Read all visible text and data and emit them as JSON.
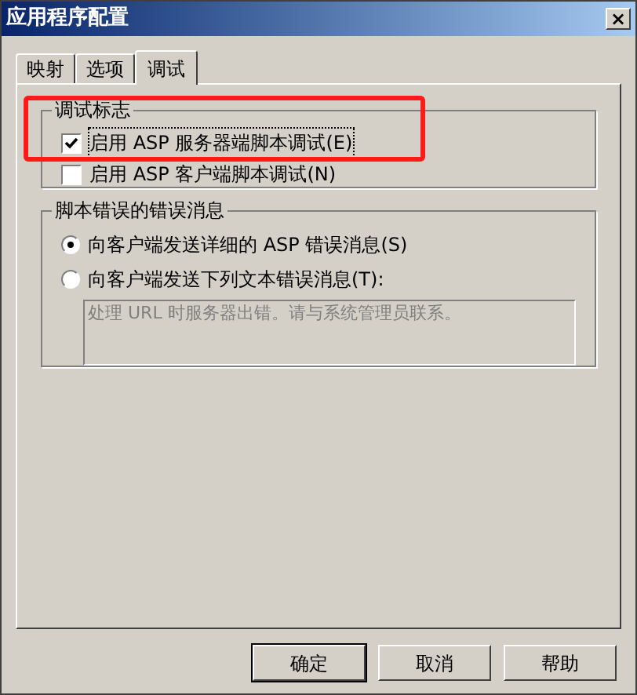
{
  "window": {
    "title": "应用程序配置",
    "close": "×"
  },
  "tabs": [
    {
      "label": "映射",
      "selected": false
    },
    {
      "label": "选项",
      "selected": false
    },
    {
      "label": "调试",
      "selected": true
    }
  ],
  "debug_flags": {
    "title": "调试标志",
    "items": [
      {
        "label": "启用 ASP 服务器端脚本调试",
        "hotkey": "(E)",
        "checked": true,
        "highlighted": true
      },
      {
        "label": "启用 ASP 客户端脚本调试",
        "hotkey": "(N)",
        "checked": false,
        "highlighted": false
      }
    ]
  },
  "script_errors": {
    "title": "脚本错误的错误消息",
    "options": [
      {
        "label": "向客户端发送详细的 ASP 错误消息",
        "hotkey": "(S)",
        "selected": true
      },
      {
        "label": "向客户端发送下列文本错误消息",
        "hotkey": "(T):",
        "selected": false
      }
    ],
    "message": {
      "value": "处理 URL 时服务器出错。请与系统管理员联系。",
      "disabled": true
    }
  },
  "buttons": [
    "确定",
    "取消",
    "帮助"
  ]
}
